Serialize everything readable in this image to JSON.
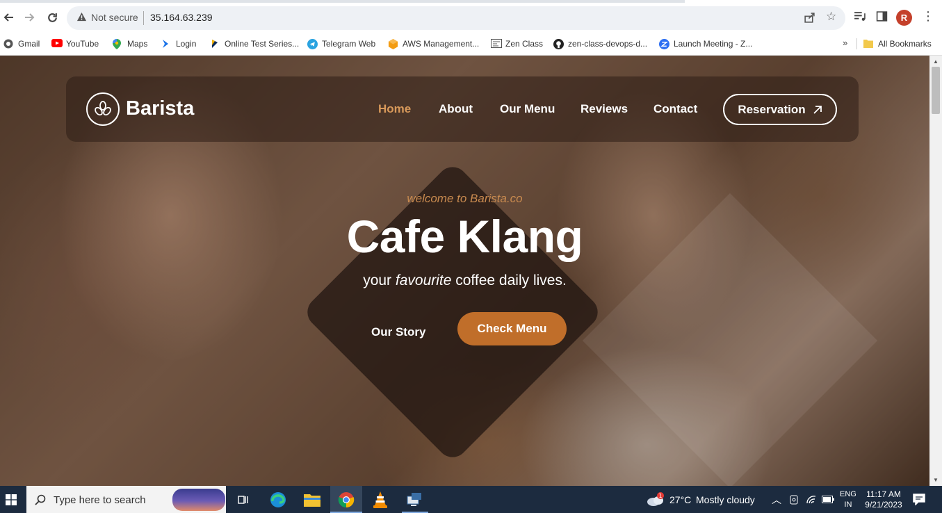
{
  "browser": {
    "security_label": "Not secure",
    "url": "35.164.63.239",
    "profile_initial": "R",
    "bookmarks": [
      {
        "label": "Gmail",
        "icon": "gmail-icon"
      },
      {
        "label": "YouTube",
        "icon": "youtube-icon"
      },
      {
        "label": "Maps",
        "icon": "maps-icon"
      },
      {
        "label": "Login",
        "icon": "login-icon"
      },
      {
        "label": "Online Test Series...",
        "icon": "test-series-icon"
      },
      {
        "label": "Telegram Web",
        "icon": "telegram-icon"
      },
      {
        "label": "AWS Management...",
        "icon": "aws-icon"
      },
      {
        "label": "Zen Class",
        "icon": "zen-class-icon"
      },
      {
        "label": "zen-class-devops-d...",
        "icon": "github-icon"
      },
      {
        "label": "Launch Meeting - Z...",
        "icon": "zoom-icon"
      }
    ],
    "overflow_label": "»",
    "all_bookmarks": "All Bookmarks"
  },
  "site": {
    "brand": "Barista",
    "nav": [
      "Home",
      "About",
      "Our Menu",
      "Reviews",
      "Contact"
    ],
    "active_nav": "Home",
    "reservation_label": "Reservation",
    "hero": {
      "welcome": "welcome to Barista.co",
      "title": "Cafe Klang",
      "subtitle_pre": "your ",
      "subtitle_em": "favourite",
      "subtitle_post": " coffee daily lives.",
      "story_label": "Our Story",
      "menu_button": "Check Menu"
    },
    "colors": {
      "accent": "#c06e2a",
      "active_nav": "#d8995a"
    }
  },
  "taskbar": {
    "search_placeholder": "Type here to search",
    "weather_temp": "27°C",
    "weather_desc": "Mostly cloudy",
    "weather_badge": "1",
    "lang_top": "ENG",
    "lang_bottom": "IN",
    "time": "11:17 AM",
    "date": "9/21/2023"
  }
}
